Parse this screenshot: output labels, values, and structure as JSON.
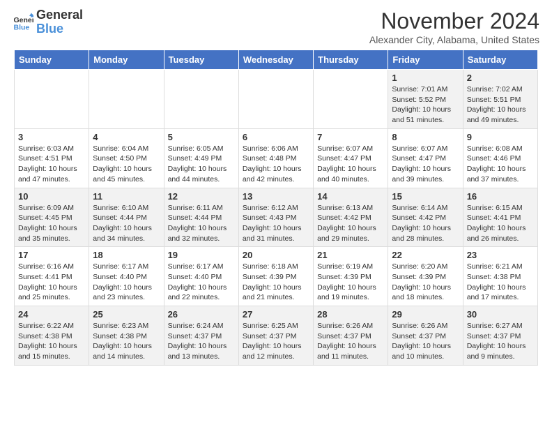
{
  "header": {
    "logo_line1": "General",
    "logo_line2": "Blue",
    "month_title": "November 2024",
    "location": "Alexander City, Alabama, United States"
  },
  "weekdays": [
    "Sunday",
    "Monday",
    "Tuesday",
    "Wednesday",
    "Thursday",
    "Friday",
    "Saturday"
  ],
  "weeks": [
    [
      {
        "day": "",
        "info": ""
      },
      {
        "day": "",
        "info": ""
      },
      {
        "day": "",
        "info": ""
      },
      {
        "day": "",
        "info": ""
      },
      {
        "day": "",
        "info": ""
      },
      {
        "day": "1",
        "info": "Sunrise: 7:01 AM\nSunset: 5:52 PM\nDaylight: 10 hours\nand 51 minutes."
      },
      {
        "day": "2",
        "info": "Sunrise: 7:02 AM\nSunset: 5:51 PM\nDaylight: 10 hours\nand 49 minutes."
      }
    ],
    [
      {
        "day": "3",
        "info": "Sunrise: 6:03 AM\nSunset: 4:51 PM\nDaylight: 10 hours\nand 47 minutes."
      },
      {
        "day": "4",
        "info": "Sunrise: 6:04 AM\nSunset: 4:50 PM\nDaylight: 10 hours\nand 45 minutes."
      },
      {
        "day": "5",
        "info": "Sunrise: 6:05 AM\nSunset: 4:49 PM\nDaylight: 10 hours\nand 44 minutes."
      },
      {
        "day": "6",
        "info": "Sunrise: 6:06 AM\nSunset: 4:48 PM\nDaylight: 10 hours\nand 42 minutes."
      },
      {
        "day": "7",
        "info": "Sunrise: 6:07 AM\nSunset: 4:47 PM\nDaylight: 10 hours\nand 40 minutes."
      },
      {
        "day": "8",
        "info": "Sunrise: 6:07 AM\nSunset: 4:47 PM\nDaylight: 10 hours\nand 39 minutes."
      },
      {
        "day": "9",
        "info": "Sunrise: 6:08 AM\nSunset: 4:46 PM\nDaylight: 10 hours\nand 37 minutes."
      }
    ],
    [
      {
        "day": "10",
        "info": "Sunrise: 6:09 AM\nSunset: 4:45 PM\nDaylight: 10 hours\nand 35 minutes."
      },
      {
        "day": "11",
        "info": "Sunrise: 6:10 AM\nSunset: 4:44 PM\nDaylight: 10 hours\nand 34 minutes."
      },
      {
        "day": "12",
        "info": "Sunrise: 6:11 AM\nSunset: 4:44 PM\nDaylight: 10 hours\nand 32 minutes."
      },
      {
        "day": "13",
        "info": "Sunrise: 6:12 AM\nSunset: 4:43 PM\nDaylight: 10 hours\nand 31 minutes."
      },
      {
        "day": "14",
        "info": "Sunrise: 6:13 AM\nSunset: 4:42 PM\nDaylight: 10 hours\nand 29 minutes."
      },
      {
        "day": "15",
        "info": "Sunrise: 6:14 AM\nSunset: 4:42 PM\nDaylight: 10 hours\nand 28 minutes."
      },
      {
        "day": "16",
        "info": "Sunrise: 6:15 AM\nSunset: 4:41 PM\nDaylight: 10 hours\nand 26 minutes."
      }
    ],
    [
      {
        "day": "17",
        "info": "Sunrise: 6:16 AM\nSunset: 4:41 PM\nDaylight: 10 hours\nand 25 minutes."
      },
      {
        "day": "18",
        "info": "Sunrise: 6:17 AM\nSunset: 4:40 PM\nDaylight: 10 hours\nand 23 minutes."
      },
      {
        "day": "19",
        "info": "Sunrise: 6:17 AM\nSunset: 4:40 PM\nDaylight: 10 hours\nand 22 minutes."
      },
      {
        "day": "20",
        "info": "Sunrise: 6:18 AM\nSunset: 4:39 PM\nDaylight: 10 hours\nand 21 minutes."
      },
      {
        "day": "21",
        "info": "Sunrise: 6:19 AM\nSunset: 4:39 PM\nDaylight: 10 hours\nand 19 minutes."
      },
      {
        "day": "22",
        "info": "Sunrise: 6:20 AM\nSunset: 4:39 PM\nDaylight: 10 hours\nand 18 minutes."
      },
      {
        "day": "23",
        "info": "Sunrise: 6:21 AM\nSunset: 4:38 PM\nDaylight: 10 hours\nand 17 minutes."
      }
    ],
    [
      {
        "day": "24",
        "info": "Sunrise: 6:22 AM\nSunset: 4:38 PM\nDaylight: 10 hours\nand 15 minutes."
      },
      {
        "day": "25",
        "info": "Sunrise: 6:23 AM\nSunset: 4:38 PM\nDaylight: 10 hours\nand 14 minutes."
      },
      {
        "day": "26",
        "info": "Sunrise: 6:24 AM\nSunset: 4:37 PM\nDaylight: 10 hours\nand 13 minutes."
      },
      {
        "day": "27",
        "info": "Sunrise: 6:25 AM\nSunset: 4:37 PM\nDaylight: 10 hours\nand 12 minutes."
      },
      {
        "day": "28",
        "info": "Sunrise: 6:26 AM\nSunset: 4:37 PM\nDaylight: 10 hours\nand 11 minutes."
      },
      {
        "day": "29",
        "info": "Sunrise: 6:26 AM\nSunset: 4:37 PM\nDaylight: 10 hours\nand 10 minutes."
      },
      {
        "day": "30",
        "info": "Sunrise: 6:27 AM\nSunset: 4:37 PM\nDaylight: 10 hours\nand 9 minutes."
      }
    ]
  ]
}
